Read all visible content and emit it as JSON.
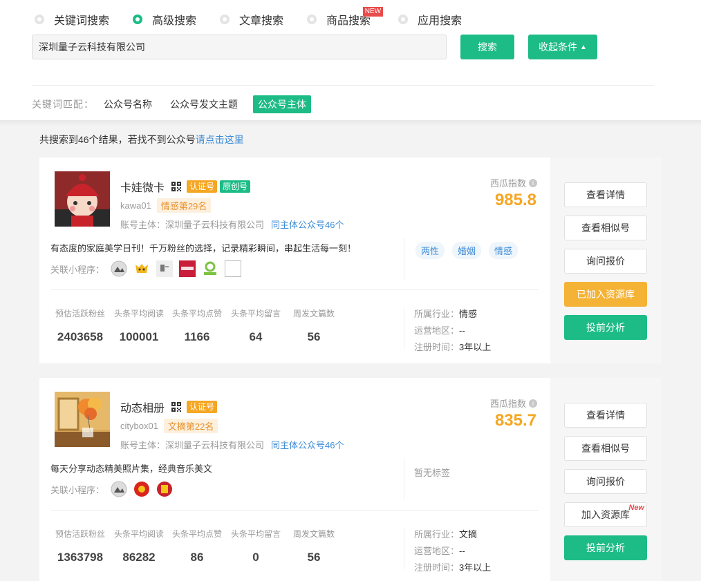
{
  "search_modes": [
    {
      "label": "关键词搜索",
      "selected": false
    },
    {
      "label": "高级搜索",
      "selected": true
    },
    {
      "label": "文章搜索",
      "selected": false
    },
    {
      "label": "商品搜索",
      "selected": false,
      "badge": "NEW"
    },
    {
      "label": "应用搜索",
      "selected": false
    }
  ],
  "search": {
    "value": "深圳量子云科技有限公司",
    "button": "搜索",
    "collapse_button": "收起条件"
  },
  "keyword_match": {
    "label": "关键词匹配：",
    "options": [
      "公众号名称",
      "公众号发文主题",
      "公众号主体"
    ],
    "active": "公众号主体"
  },
  "result_summary": {
    "text": "共搜索到46个结果，若找不到公众号",
    "link": "请点击这里"
  },
  "cards": [
    {
      "name": "卡娃微卡",
      "badges": [
        "认证号",
        "原创号"
      ],
      "account_id": "kawa01",
      "rank": "情感第29名",
      "subject_label": "账号主体：深圳量子云科技有限公司",
      "same_subject_link": "同主体公众号46个",
      "index_label": "西瓜指数",
      "index_value": "985.8",
      "description": "有态度的家庭美学日刊！千万粉丝的选择，记录精彩瞬间，串起生活每一刻！",
      "mini_label": "关联小程序：",
      "tags": [
        "两性",
        "婚姻",
        "情感"
      ],
      "stats_headers": [
        "预估活跃粉丝",
        "头条平均阅读",
        "头条平均点赞",
        "头条平均留言",
        "周发文篇数"
      ],
      "stats_values": [
        "2403658",
        "100001",
        "1166",
        "64",
        "56"
      ],
      "industry": {
        "label": "所属行业：",
        "value": "情感"
      },
      "region": {
        "label": "运营地区：",
        "value": "--"
      },
      "reg_time": {
        "label": "注册时间：",
        "value": "3年以上"
      },
      "actions": [
        "查看详情",
        "查看相似号",
        "询问报价",
        "已加入资源库",
        "投前分析"
      ]
    },
    {
      "name": "动态相册",
      "badges": [
        "认证号"
      ],
      "account_id": "citybox01",
      "rank": "文摘第22名",
      "subject_label": "账号主体：深圳量子云科技有限公司",
      "same_subject_link": "同主体公众号46个",
      "index_label": "西瓜指数",
      "index_value": "835.7",
      "description": "每天分享动态精美照片集，经典音乐美文",
      "mini_label": "关联小程序：",
      "no_tags": "暂无标签",
      "stats_headers": [
        "预估活跃粉丝",
        "头条平均阅读",
        "头条平均点赞",
        "头条平均留言",
        "周发文篇数"
      ],
      "stats_values": [
        "1363798",
        "86282",
        "86",
        "0",
        "56"
      ],
      "industry": {
        "label": "所属行业：",
        "value": "文摘"
      },
      "region": {
        "label": "运营地区：",
        "value": "--"
      },
      "reg_time": {
        "label": "注册时间：",
        "value": "3年以上"
      },
      "actions": [
        "查看详情",
        "查看相似号",
        "询问报价",
        "加入资源库",
        "投前分析"
      ],
      "new_badge": "New"
    }
  ],
  "colors": {
    "accent": "#1dbc86",
    "orange": "#f5a623",
    "link": "#3d8bd6"
  }
}
